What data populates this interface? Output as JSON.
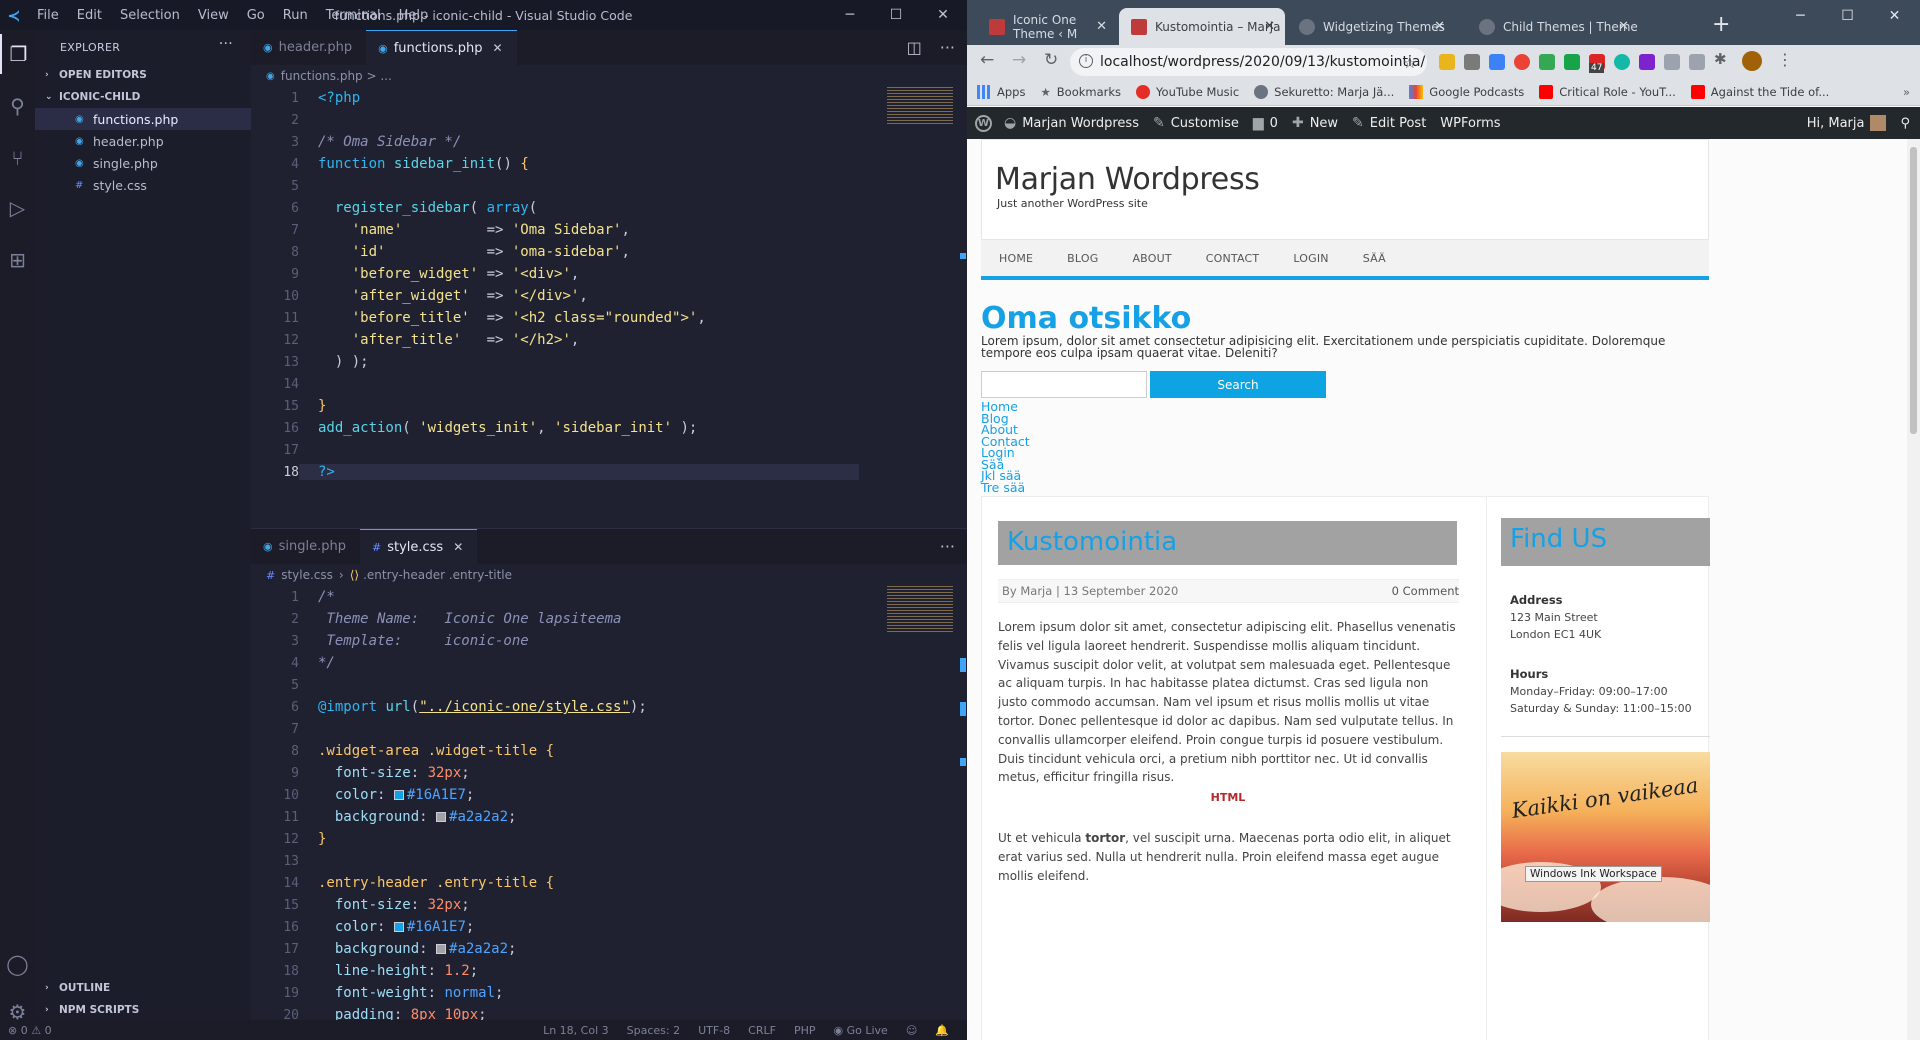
{
  "vscode": {
    "window_title": "functions.php - iconic-child - Visual Studio Code",
    "menu": [
      "File",
      "Edit",
      "Selection",
      "View",
      "Go",
      "Run",
      "Terminal",
      "Help"
    ],
    "explorer": {
      "title": "EXPLORER",
      "open_editors": "OPEN EDITORS",
      "folder": "ICONIC-CHILD",
      "files": [
        "functions.php",
        "header.php",
        "single.php",
        "style.css"
      ],
      "outline": "OUTLINE",
      "npm_scripts": "NPM SCRIPTS"
    },
    "editor_top": {
      "tabs": [
        {
          "label": "header.php",
          "active": false
        },
        {
          "label": "functions.php",
          "active": true
        }
      ],
      "breadcrumb": "functions.php > ..."
    },
    "editor_bottom": {
      "tabs": [
        {
          "label": "single.php",
          "active": false
        },
        {
          "label": "style.css",
          "active": true
        }
      ],
      "breadcrumb_file": "style.css",
      "breadcrumb_symbol": ".entry-header .entry-title"
    },
    "statusbar": {
      "problems": "⊗ 0 ⚠ 0",
      "position": "Ln 18, Col 3",
      "spaces": "Spaces: 2",
      "encoding": "UTF-8",
      "eol": "CRLF",
      "language": "PHP",
      "golive": "Go Live"
    }
  },
  "chrome": {
    "tabs": [
      {
        "label": "Iconic One Theme ‹ M",
        "active": false
      },
      {
        "label": "Kustomointia – Marja",
        "active": true
      },
      {
        "label": "Widgetizing Themes",
        "active": false
      },
      {
        "label": "Child Themes | Theme",
        "active": false
      }
    ],
    "url": "localhost/wordpress/2020/09/13/kustomointia/",
    "bookmarks": [
      "Apps",
      "Bookmarks",
      "YouTube Music",
      "Sekuretto: Marja Jä...",
      "Google Podcasts",
      "Critical Role - YouT...",
      "Against the Tide of..."
    ],
    "ext_badge": "47"
  },
  "wp": {
    "adminbar": {
      "site": "Marjan Wordpress",
      "customise": "Customise",
      "comments": "0",
      "new": "New",
      "edit": "Edit Post",
      "wpforms": "WPForms",
      "greeting": "Hi, Marja"
    },
    "site_title": "Marjan Wordpress",
    "tagline": "Just another WordPress site",
    "nav": [
      "HOME",
      "BLOG",
      "ABOUT",
      "CONTACT",
      "LOGIN",
      "SÄÄ"
    ],
    "widget_title": "Oma otsikko",
    "widget_text": "Lorem ipsum, dolor sit amet consectetur adipisicing elit. Exercitationem unde perspiciatis cupiditate. Doloremque tempore eos culpa ipsam quaerat vitae. Deleniti?",
    "search_button": "Search",
    "widget_menu": [
      "Home",
      "Blog",
      "About",
      "Contact",
      "Login",
      "Sää",
      "Jkl sää",
      "Tre sää"
    ],
    "post": {
      "title": "Kustomointia",
      "meta_prefix": "By",
      "author": "Marja",
      "date": "13 September 2020",
      "comments": "0 Comment",
      "body": "Lorem ipsum dolor sit amet, consectetur adipiscing elit. Phasellus venenatis felis vel ligula laoreet hendrerit. Suspendisse mollis aliquam tincidunt. Vivamus suscipit dolor velit, at volutpat sem malesuada eget. Pellentesque ac aliquam turpis. In hac habitasse platea dictumst. Cras sed ligula non justo commodo accumsan. Nam vel ipsum et risus mollis mollis ut vitae tortor. Donec pellentesque id dolor ac dapibus. Nam sed vulputate tellus. In convallis ullamcorper eleifend. Proin congue turpis id posuere vestibulum. Duis tincidunt vehicula orci, a pretium nibh porttitor nec. Ut id convallis metus, efficitur fringilla risus.",
      "html_label": "HTML",
      "body2_start": "Ut et vehicula ",
      "body2_bold": "tortor",
      "body2_end": ", vel suscipit urna. Maecenas porta odio elit, in aliquet erat varius sed. Nulla ut hendrerit nulla. Proin eleifend massa eget augue mollis eleifend."
    },
    "aside": {
      "title": "Find US",
      "address_h": "Address",
      "address_1": "123 Main Street",
      "address_2": "London EC1 4UK",
      "hours_h": "Hours",
      "hours_1": "Monday–Friday: 09:00–17:00",
      "hours_2": "Saturday & Sunday: 11:00–15:00",
      "image_caption": "Kaikki on vaikeaa"
    },
    "tooltip": "Windows Ink Workspace"
  }
}
